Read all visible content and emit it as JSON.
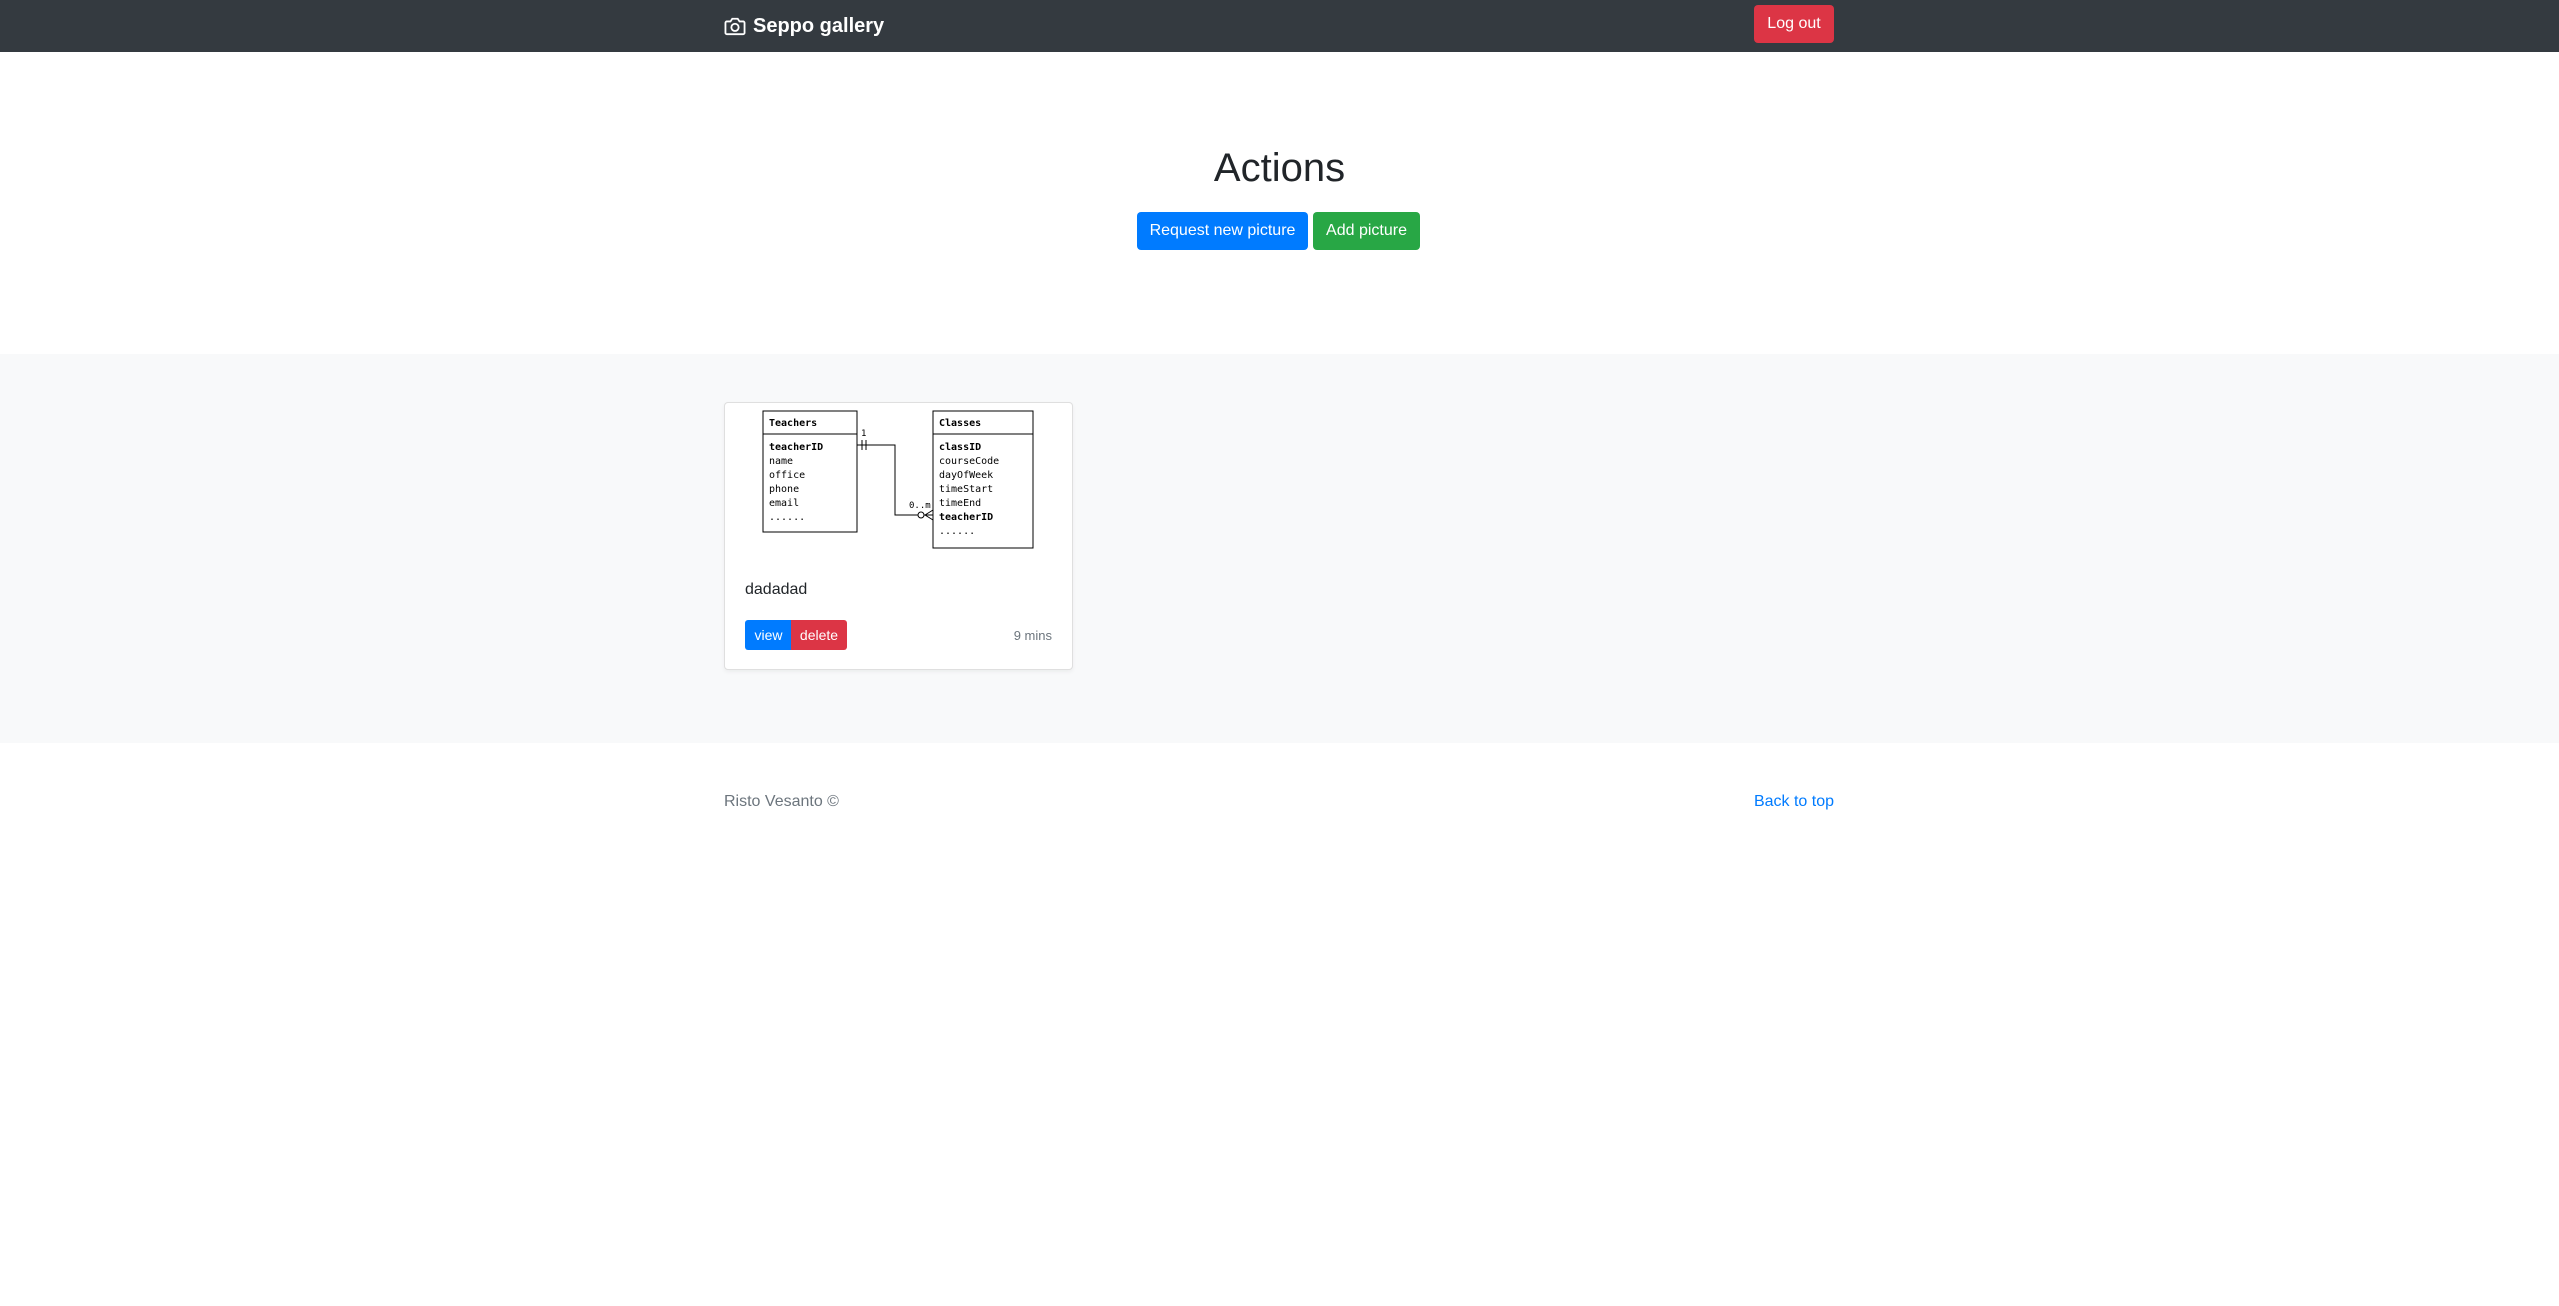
{
  "navbar": {
    "brand": "Seppo gallery",
    "brand_icon": "camera-icon",
    "logout_label": "Log out"
  },
  "actions": {
    "title": "Actions",
    "request_label": "Request new picture",
    "add_label": "Add picture"
  },
  "gallery": {
    "cards": [
      {
        "caption": "dadadad",
        "view_label": "view",
        "delete_label": "delete",
        "time": "9 mins",
        "thumbnail": {
          "left_table": {
            "name": "Teachers",
            "fields": [
              "teacherID",
              "name",
              "office",
              "phone",
              "email",
              "......"
            ]
          },
          "right_table": {
            "name": "Classes",
            "fields": [
              "classID",
              "courseCode",
              "dayOfWeek",
              "timeStart",
              "timeEnd",
              "teacherID",
              "......"
            ]
          },
          "cardinality_left": "1",
          "cardinality_right": "0..m"
        }
      }
    ]
  },
  "footer": {
    "credit": "Risto Vesanto ©",
    "back_to_top": "Back to top"
  },
  "colors": {
    "navbar_bg": "#343a40",
    "primary": "#007bff",
    "success": "#28a745",
    "danger": "#dc3545",
    "muted": "#6c757d"
  }
}
